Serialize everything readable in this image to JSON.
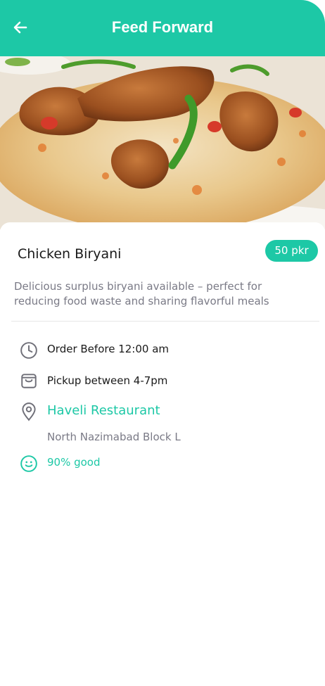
{
  "header": {
    "title": "Feed Forward",
    "back_icon": "arrow-left-icon"
  },
  "item": {
    "name": "Chicken Biryani",
    "price": "50 pkr",
    "description": "Delicious surplus biryani available – perfect for reducing food waste and sharing flavorful meals"
  },
  "details": {
    "order_before": "Order Before 12:00 am",
    "pickup": "Pickup between 4-7pm",
    "restaurant": "Haveli Restaurant",
    "address": "North Nazimabad  Block L",
    "rating": "90% good"
  },
  "colors": {
    "accent": "#1dc8a6",
    "muted_text": "#7a7a86"
  },
  "icons": [
    "arrow-left-icon",
    "clock-icon",
    "shopping-bag-icon",
    "location-pin-icon",
    "smile-icon"
  ]
}
